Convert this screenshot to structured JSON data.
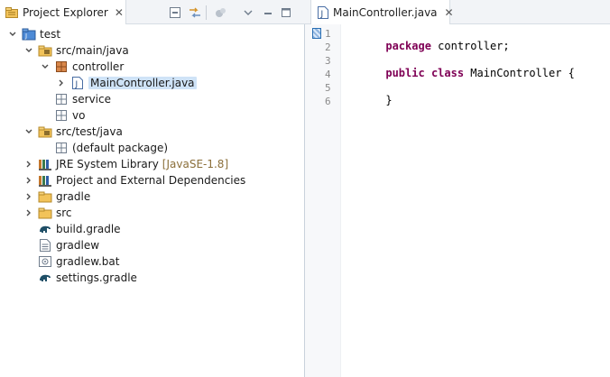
{
  "left_panel": {
    "tab": {
      "label": "Project Explorer",
      "close": "✕"
    },
    "toolbar": {
      "buttons": [
        {
          "name": "collapse-all-icon"
        },
        {
          "name": "link-with-editor-icon"
        },
        {
          "name": "focus-icon"
        },
        {
          "name": "view-menu-icon"
        },
        {
          "name": "minimize-icon"
        },
        {
          "name": "maximize-icon"
        }
      ]
    },
    "tree": [
      {
        "label": "test",
        "level": 0,
        "expanded": true,
        "icon": "project-icon"
      },
      {
        "label": "src/main/java",
        "level": 1,
        "expanded": true,
        "icon": "source-folder-icon"
      },
      {
        "label": "controller",
        "level": 2,
        "expanded": true,
        "icon": "package-icon"
      },
      {
        "label": "MainController.java",
        "level": 3,
        "expanded": false,
        "icon": "java-file-icon",
        "selected": true
      },
      {
        "label": "service",
        "level": 2,
        "expanded": null,
        "icon": "package-icon"
      },
      {
        "label": "vo",
        "level": 2,
        "expanded": null,
        "icon": "package-icon"
      },
      {
        "label": "src/test/java",
        "level": 1,
        "expanded": true,
        "icon": "source-folder-icon"
      },
      {
        "label": "(default package)",
        "level": 2,
        "expanded": null,
        "icon": "package-icon"
      },
      {
        "label": "JRE System Library",
        "label2": "[JavaSE-1.8]",
        "level": 1,
        "expanded": false,
        "icon": "library-icon"
      },
      {
        "label": "Project and External Dependencies",
        "level": 1,
        "expanded": false,
        "icon": "library-icon"
      },
      {
        "label": "gradle",
        "level": 1,
        "expanded": false,
        "icon": "folder-icon"
      },
      {
        "label": "src",
        "level": 1,
        "expanded": false,
        "icon": "folder-icon"
      },
      {
        "label": "build.gradle",
        "level": 1,
        "expanded": null,
        "icon": "gradle-icon"
      },
      {
        "label": "gradlew",
        "level": 1,
        "expanded": null,
        "icon": "text-file-icon"
      },
      {
        "label": "gradlew.bat",
        "level": 1,
        "expanded": null,
        "icon": "bat-file-icon"
      },
      {
        "label": "settings.gradle",
        "level": 1,
        "expanded": null,
        "icon": "gradle-icon"
      }
    ]
  },
  "editor": {
    "tab": {
      "label": "MainController.java",
      "close": "✕"
    },
    "lines": [
      {
        "num": "1",
        "parts": [
          {
            "text": "package",
            "kw": true
          },
          {
            "text": " controller;",
            "kw": false
          }
        ]
      },
      {
        "num": "2",
        "parts": []
      },
      {
        "num": "3",
        "parts": [
          {
            "text": "public",
            "kw": true
          },
          {
            "text": " ",
            "kw": false
          },
          {
            "text": "class",
            "kw": true
          },
          {
            "text": " MainController {",
            "kw": false
          }
        ]
      },
      {
        "num": "4",
        "parts": []
      },
      {
        "num": "5",
        "parts": [
          {
            "text": "}",
            "kw": false
          }
        ]
      },
      {
        "num": "6",
        "parts": []
      }
    ]
  },
  "colors": {
    "keyword": "#7f0055",
    "selection": "#cfe3f7",
    "library_version": "#8b6f3a"
  }
}
